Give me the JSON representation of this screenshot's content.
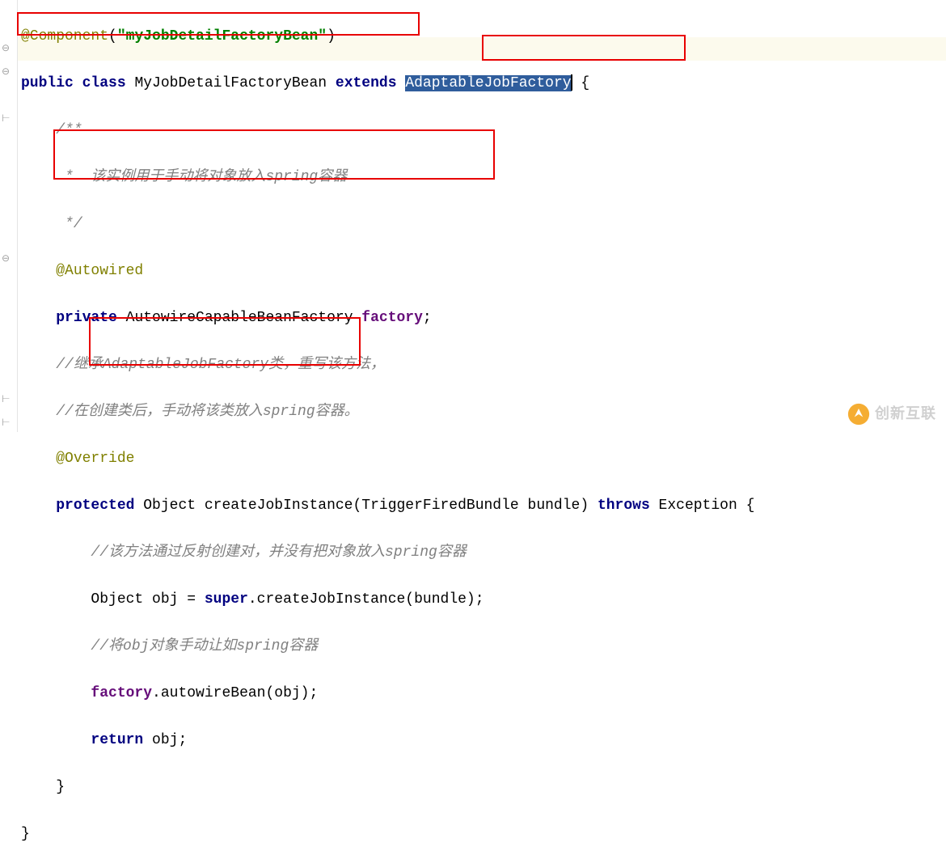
{
  "lines": {
    "l1_ann": "@Component",
    "l1_paren_open": "(",
    "l1_str": "\"myJobDetailFactoryBean\"",
    "l1_paren_close": ")",
    "l2_kw1": "public",
    "l2_kw2": "class",
    "l2_name": " MyJobDetailFactoryBean ",
    "l2_kw3": "extends",
    "l2_sel": "AdaptableJobFactory",
    "l2_brace": " {",
    "l3": "/**",
    "l4": " *  该实例用于手动将对象放入spring容器",
    "l5": " */",
    "l6_ann": "@Autowired",
    "l7_kw": "private",
    "l7_type": " AutowireCapableBeanFactory ",
    "l7_field": "factory",
    "l7_semi": ";",
    "l8": "//继承AdaptableJobFactory类，重写该方法，",
    "l9": "//在创建类后，手动将该类放入spring容器。",
    "l10_ann": "@Override",
    "l11_kw1": "protected",
    "l11_type": " Object createJobInstance(TriggerFiredBundle bundle) ",
    "l11_kw2": "throws",
    "l11_rest": " Exception {",
    "l12": "//该方法通过反射创建对，并没有把对象放入spring容器",
    "l13_a": "Object obj = ",
    "l13_kw": "super",
    "l13_b": ".createJobInstance(bundle);",
    "l14": "//将obj对象手动让如spring容器",
    "l15_field": "factory",
    "l15_rest": ".autowireBean(obj);",
    "l16_kw": "return",
    "l16_rest": " obj;",
    "l17": "}",
    "l18": "}"
  },
  "watermark": "创新互联"
}
